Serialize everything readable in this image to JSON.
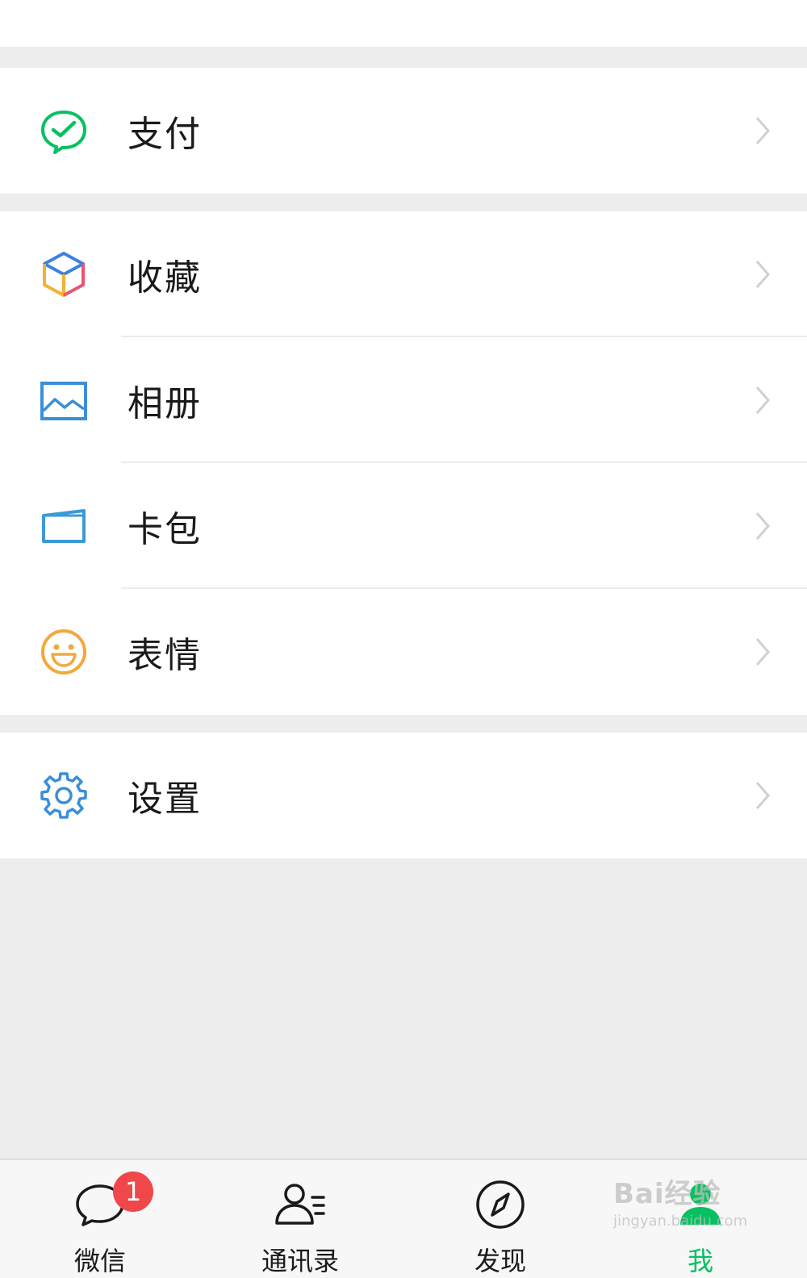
{
  "menu": {
    "pay": {
      "label": "支付",
      "icon": "wechat-pay-icon"
    },
    "favorites": {
      "label": "收藏",
      "icon": "cube-icon"
    },
    "album": {
      "label": "相册",
      "icon": "image-icon"
    },
    "wallet": {
      "label": "卡包",
      "icon": "card-icon"
    },
    "stickers": {
      "label": "表情",
      "icon": "smiley-icon"
    },
    "settings": {
      "label": "设置",
      "icon": "gear-icon"
    }
  },
  "tabbar": {
    "tabs": [
      {
        "label": "微信",
        "icon": "chat-bubble-icon",
        "badge": "1"
      },
      {
        "label": "通讯录",
        "icon": "contacts-icon"
      },
      {
        "label": "发现",
        "icon": "compass-icon"
      },
      {
        "label": "我",
        "icon": "person-icon",
        "active": true
      }
    ]
  },
  "watermark": {
    "main": "Bai经验",
    "sub": "jingyan.baidu.com"
  },
  "colors": {
    "accent_green": "#07c160",
    "badge_red": "#f0474a",
    "background": "#ededed"
  }
}
